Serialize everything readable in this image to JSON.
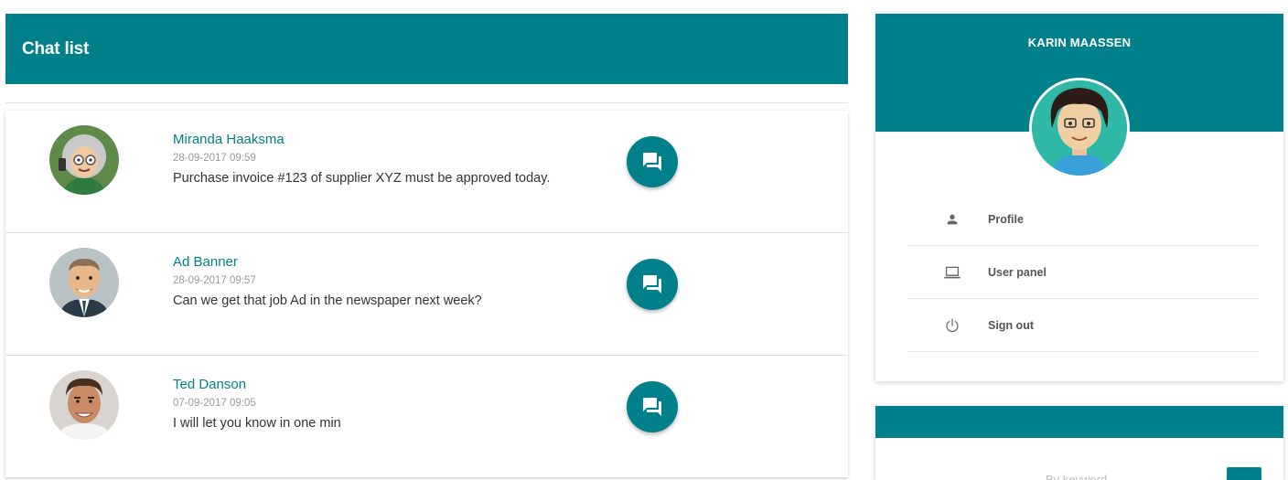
{
  "chat_list": {
    "title": "Chat list",
    "items": [
      {
        "name": "Miranda Haaksma",
        "date": "28-09-2017 09:59",
        "message": "Purchase invoice #123 of supplier XYZ must be approved today."
      },
      {
        "name": "Ad Banner",
        "date": "28-09-2017 09:57",
        "message": "Can we get that job Ad in the newspaper next week?"
      },
      {
        "name": "Ted Danson",
        "date": "07-09-2017 09:05",
        "message": "I will let you know in one min"
      }
    ]
  },
  "profile": {
    "name": "KARIN MAASSEN",
    "menu": [
      {
        "label": "Profile",
        "icon": "person-icon"
      },
      {
        "label": "User panel",
        "icon": "laptop-icon"
      },
      {
        "label": "Sign out",
        "icon": "power-icon"
      }
    ]
  },
  "second_card": {
    "placeholder_partial": "Bv keyword"
  },
  "colors": {
    "primary": "#00808a"
  }
}
